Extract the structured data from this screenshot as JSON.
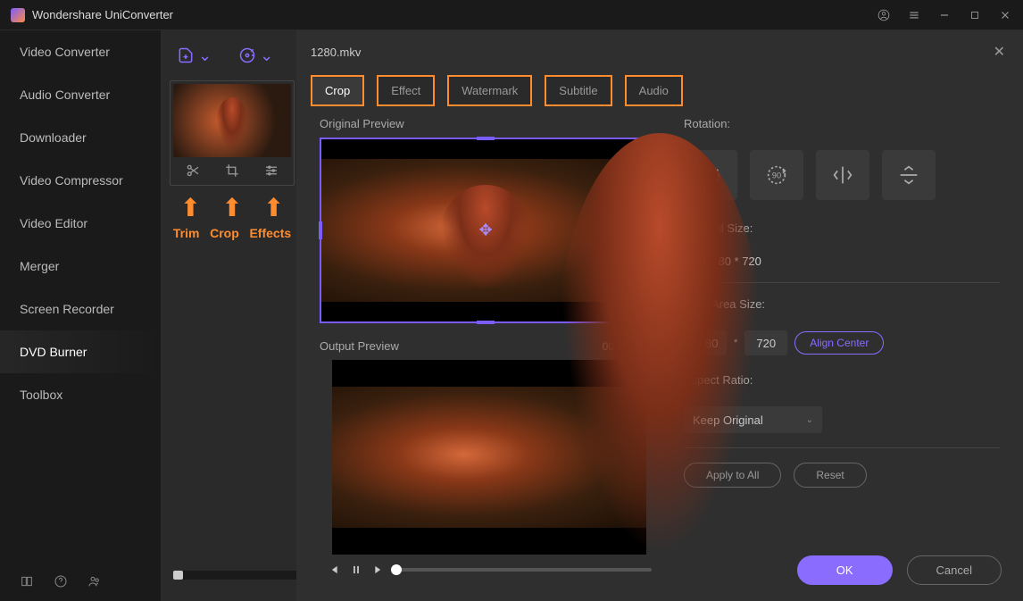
{
  "app": {
    "title": "Wondershare UniConverter"
  },
  "sidebar": {
    "items": [
      {
        "label": "Video Converter"
      },
      {
        "label": "Audio Converter"
      },
      {
        "label": "Downloader"
      },
      {
        "label": "Video Compressor"
      },
      {
        "label": "Video Editor"
      },
      {
        "label": "Merger"
      },
      {
        "label": "Screen Recorder"
      },
      {
        "label": "DVD Burner"
      },
      {
        "label": "Toolbox"
      }
    ],
    "active_index": 7
  },
  "annotations": {
    "trim": "Trim",
    "crop": "Crop",
    "effects": "Effects"
  },
  "editor": {
    "filename": "1280.mkv",
    "tabs": [
      {
        "label": "Crop"
      },
      {
        "label": "Effect"
      },
      {
        "label": "Watermark"
      },
      {
        "label": "Subtitle"
      },
      {
        "label": "Audio"
      }
    ],
    "active_tab": 0,
    "original_label": "Original Preview",
    "output_label": "Output Preview",
    "time": "00:00/00:55",
    "rotation_label": "Rotation:",
    "rotate_left": "90",
    "rotate_right": "90",
    "original_size_label": "Original Size:",
    "original_size_value": "1280 * 720",
    "crop_size_label": "Crop Area Size:",
    "crop_w": "1280",
    "crop_h": "720",
    "align_center": "Align Center",
    "aspect_label": "Aspect Ratio:",
    "aspect_value": "Keep Original",
    "apply_all": "Apply to All",
    "reset": "Reset",
    "ok": "OK",
    "cancel": "Cancel"
  }
}
